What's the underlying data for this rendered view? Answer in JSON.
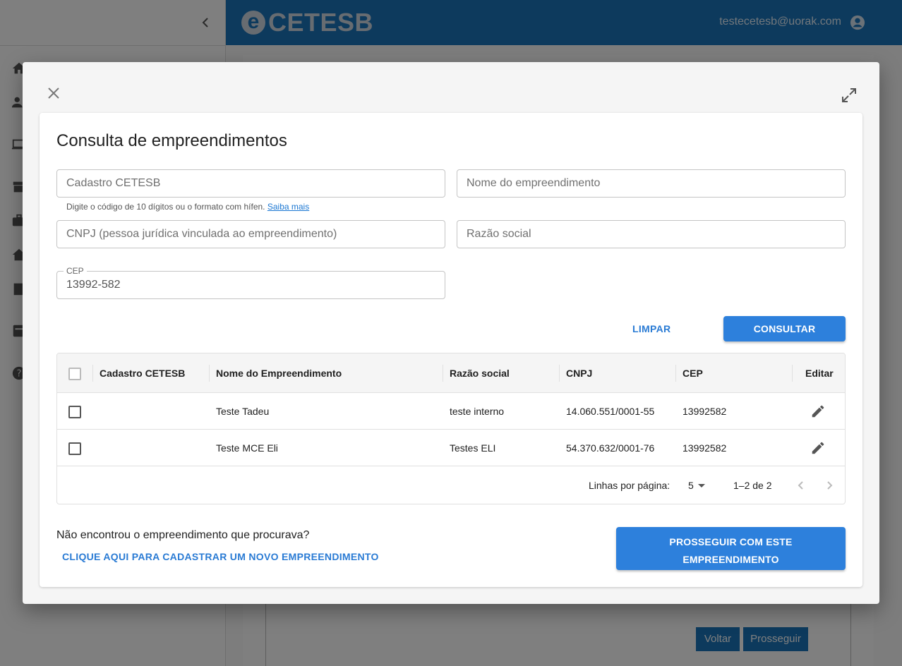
{
  "app": {
    "logo_letter": "e",
    "logo_text": "CETESB",
    "user_email": "testecetesb@uorak.com",
    "back_buttons": {
      "voltar": "Voltar",
      "prosseguir": "Prosseguir"
    },
    "header_color": "#1b75bb"
  },
  "dialog": {
    "title": "Consulta de empreendimentos",
    "fields": {
      "cadastro": {
        "placeholder": "Cadastro CETESB",
        "value": ""
      },
      "nome": {
        "placeholder": "Nome do empreendimento",
        "value": ""
      },
      "cnpj": {
        "placeholder": "CNPJ (pessoa jurídica vinculada ao empreendimento)",
        "value": ""
      },
      "razao": {
        "placeholder": "Razão social",
        "value": ""
      },
      "cep": {
        "label": "CEP",
        "value": "13992-582"
      }
    },
    "helper_text": "Digite o código de 10 dígitos ou o formato com hífen.",
    "helper_link": "Saiba mais",
    "buttons": {
      "limpar": "LIMPAR",
      "consultar": "CONSULTAR"
    },
    "table": {
      "headers": {
        "cadastro": "Cadastro CETESB",
        "nome": "Nome do Empreendimento",
        "razao": "Razão social",
        "cnpj": "CNPJ",
        "cep": "CEP",
        "editar": "Editar"
      },
      "rows": [
        {
          "cadastro": "",
          "nome": "Teste Tadeu",
          "razao": "teste interno",
          "cnpj": "14.060.551/0001-55",
          "cep": "13992582"
        },
        {
          "cadastro": "",
          "nome": "Teste MCE Eli",
          "razao": "Testes ELI",
          "cnpj": "54.370.632/0001-76",
          "cep": "13992582"
        }
      ],
      "footer": {
        "rows_per_page_label": "Linhas por página:",
        "rows_per_page": "5",
        "range": "1–2 de 2"
      }
    },
    "not_found_text": "Não encontrou o empreendimento que procurava?",
    "cadastrar_link": "CLIQUE AQUI PARA CADASTRAR UM NOVO EMPREENDIMENTO",
    "prosseguir": {
      "line1": "PROSSEGUIR COM ESTE",
      "line2": "EMPREENDIMENTO"
    },
    "accent_color": "#2d80dc"
  }
}
